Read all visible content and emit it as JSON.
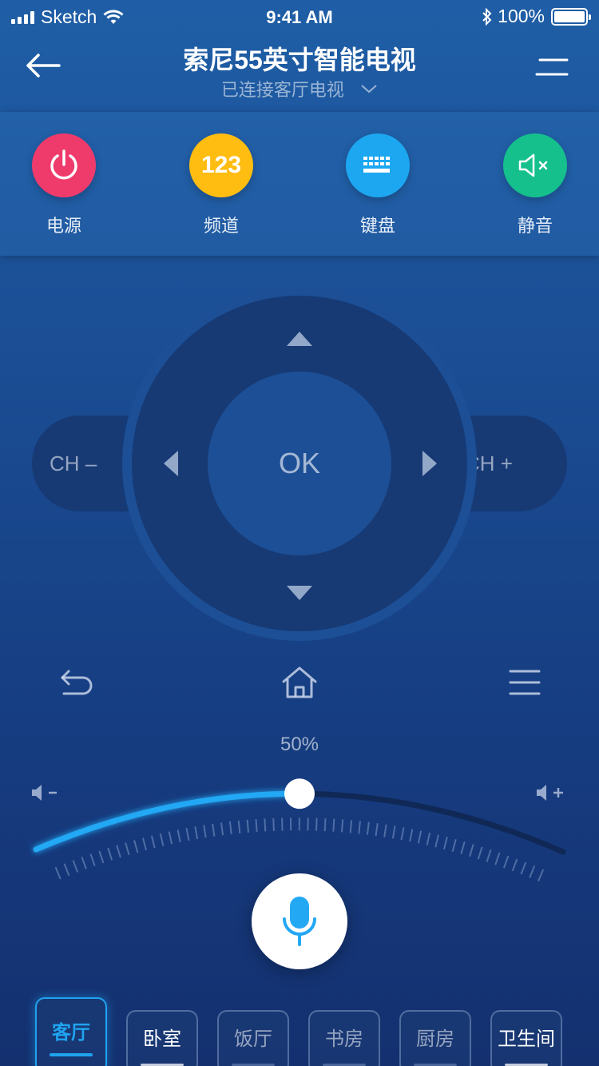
{
  "status_bar": {
    "carrier": "Sketch",
    "time": "9:41 AM",
    "battery": "100%"
  },
  "header": {
    "title": "索尼55英寸智能电视",
    "subtitle": "已连接客厅电视"
  },
  "quick_actions": {
    "power": "电源",
    "channel_icon_text": "123",
    "channel": "频道",
    "keyboard": "键盘",
    "mute": "静音"
  },
  "dpad": {
    "ok": "OK",
    "ch_minus": "CH –",
    "ch_plus": "CH +"
  },
  "volume": {
    "label": "50%",
    "level": 0.5
  },
  "rooms": [
    "客厅",
    "卧室",
    "饭厅",
    "书房",
    "厨房",
    "卫生间"
  ],
  "active_room": "客厅",
  "colors": {
    "power": "#ef3b6b",
    "channel": "#ffbd12",
    "keyboard": "#1da7f1",
    "mute": "#15c08d",
    "accent": "#1fa3ef"
  }
}
